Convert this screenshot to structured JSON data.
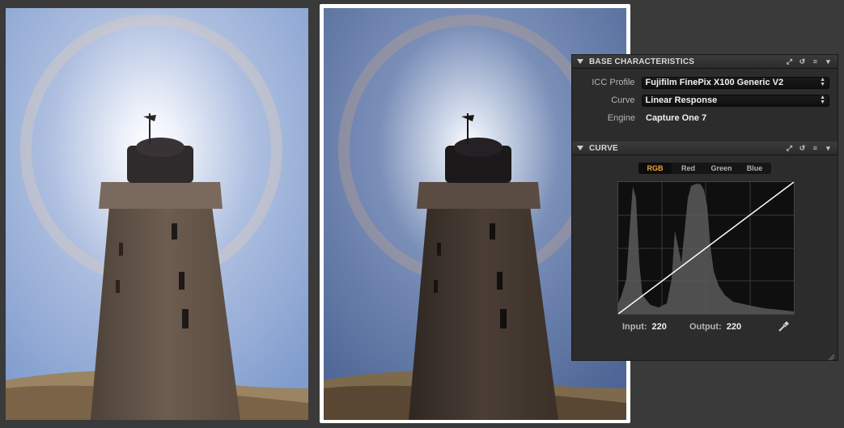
{
  "base_characteristics": {
    "title": "BASE CHARACTERISTICS",
    "icc_profile_label": "ICC Profile",
    "icc_profile_value": "Fujifilm FinePix X100 Generic V2",
    "curve_label": "Curve",
    "curve_value": "Linear Response",
    "engine_label": "Engine",
    "engine_value": "Capture One 7"
  },
  "curve": {
    "title": "CURVE",
    "channels": [
      "RGB",
      "Red",
      "Green",
      "Blue"
    ],
    "active_channel": "RGB",
    "input_label": "Input:",
    "input_value": "220",
    "output_label": "Output:",
    "output_value": "220"
  },
  "icons": [
    "collapse-triangle-icon",
    "expand-icon",
    "reset-icon",
    "menu-icon",
    "dropdown-icon",
    "picker-icon",
    "resize-grip-icon"
  ],
  "colors": {
    "accent": "#f2a83a",
    "panel_bg": "#2c2c2c"
  }
}
